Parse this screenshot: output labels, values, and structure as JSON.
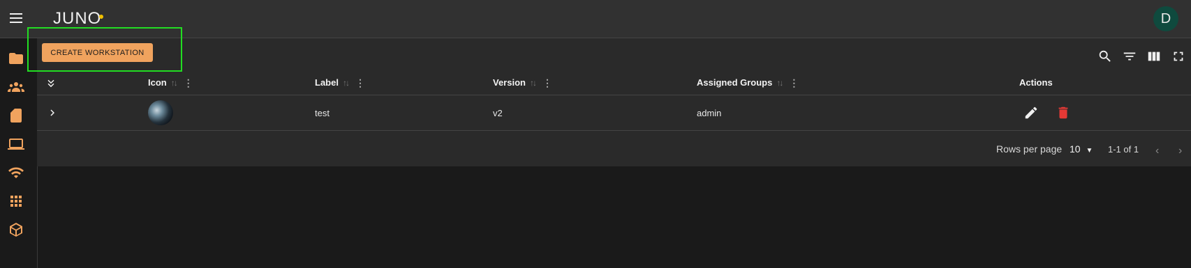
{
  "app": {
    "logo_text": "JUNO",
    "avatar_letter": "D"
  },
  "toolbar": {
    "create_label": "CREATE WORKSTATION"
  },
  "table": {
    "columns": [
      "Icon",
      "Label",
      "Version",
      "Assigned Groups",
      "Actions"
    ],
    "rows": [
      {
        "label": "test",
        "version": "v2",
        "groups": "admin"
      }
    ]
  },
  "footer": {
    "rows_per_page_label": "Rows per page",
    "rows_per_page_value": "10",
    "range": "1-1 of 1"
  },
  "icons": {
    "sidebar": [
      "folder-icon",
      "groups-icon",
      "sd-card-icon",
      "laptop-icon",
      "wifi-icon",
      "apps-grid-icon",
      "package-icon"
    ],
    "tools": [
      "search-icon",
      "filter-icon",
      "columns-icon",
      "fullscreen-icon"
    ]
  },
  "colors": {
    "accent": "#f0a35e",
    "highlight": "#22dd22",
    "delete": "#e53935",
    "avatar_bg": "#0f4a3e"
  }
}
